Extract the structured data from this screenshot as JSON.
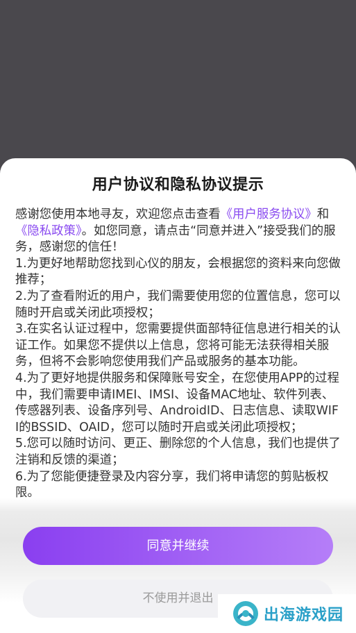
{
  "dialog": {
    "title": "用户协议和隐私协议提示",
    "intro_before": "感谢您使用本地寻友，欢迎您点击查看",
    "link_user_agreement": "《用户服务协议》",
    "intro_and": "和",
    "link_privacy_policy": "《隐私政策》",
    "intro_after": "。如您同意，请点击“同意并进入”接受我们的服务，感谢您的信任！",
    "items": [
      "1.为更好地帮助您找到心仪的朋友，会根据您的资料来向您做推荐；",
      "2.为了查看附近的用户，我们需要使用您的位置信息，您可以随时开启或关闭此项授权；",
      "3.在实名认证过程中，您需要提供面部特征信息进行相关的认证工作。如果您不提供以上信息，您将可能无法获得相关服务，但将不会影响您使用我们产品或服务的基本功能。",
      "4.为了更好地提供服务和保障账号安全，在您使用APP的过程中，我们需要申请IMEI、IMSI、设备MAC地址、软件列表、传感器列表、设备序列号、AndroidID、日志信息、读取WIFI的BSSID、OAID，您可以随时开启或关闭此项授权；",
      "5.您可以随时访问、更正、删除您的个人信息，我们也提供了注销和反馈的渠道；",
      "6.为了您能便捷登录及内容分享，我们将申请您的剪贴板权限。"
    ],
    "agree_label": "同意并继续",
    "decline_label": "不使用并退出"
  },
  "watermark": {
    "text": "出海游戏园"
  },
  "colors": {
    "overlay": "#4a484d",
    "link": "#8a4bf0",
    "accent_start": "#8a3ff0",
    "accent_end": "#b57ef8",
    "decline_bg": "#f1f1f4"
  }
}
